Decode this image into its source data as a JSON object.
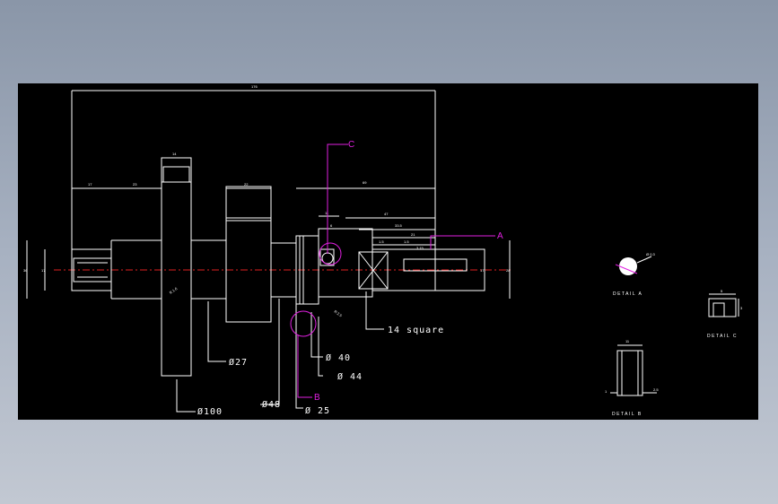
{
  "colors": {
    "background": "#000000",
    "geometry": "#ffffff",
    "callout": "#e020e0",
    "centerline": "#e02020"
  },
  "dimensions": {
    "overall_length": "176",
    "flange_width": "14",
    "left_end": "17",
    "left_neck": "23",
    "hub_width": "22",
    "right_section": "69",
    "right_end": "47",
    "groove_offset": "11",
    "groove_small": "6",
    "slot_a": "33.5",
    "slot_b": "21",
    "slot_c": "1.5",
    "slot_d": "1.5",
    "slot_e": "3.15",
    "left_height": "36",
    "left_inner": "17",
    "right_height": "28",
    "right_inner": "17",
    "fillet_flange": "R 1.6",
    "fillet_right": "R 2.5"
  },
  "labels": {
    "d100": "Ø100",
    "d48": "Ø48",
    "d27": "Ø27",
    "d25": "Ø 25",
    "d40": "Ø 40",
    "d44": "Ø 44",
    "square": "14 square"
  },
  "callouts": {
    "a": "A",
    "b": "B",
    "c": "C"
  },
  "details": {
    "detail_a": "DETAIL A",
    "detail_b": "DETAIL B",
    "detail_c": "DETAIL C",
    "detail_a_radius": "Ø 0.3",
    "detail_b_width": "11",
    "detail_b_left": "1",
    "detail_b_right": "2.5",
    "detail_c_width": "5",
    "detail_c_height": "3"
  }
}
